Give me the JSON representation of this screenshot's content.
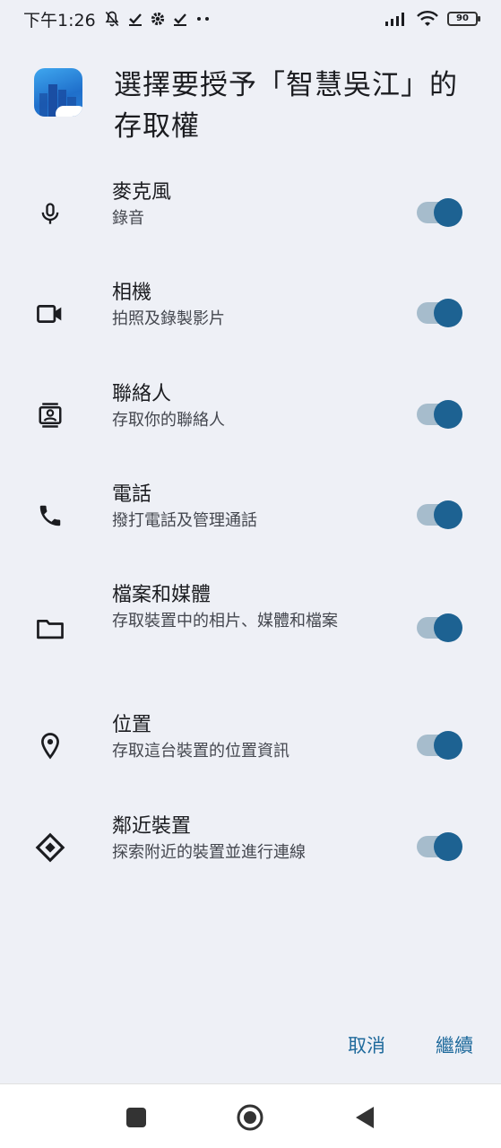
{
  "status_bar": {
    "time": "下午1:26",
    "battery": "90",
    "left_icons": [
      "mute-icon",
      "check-icon",
      "gear-icon",
      "check-icon",
      "more-dots-icon"
    ],
    "right_icons": [
      "signal-icon",
      "wifi-icon",
      "battery-icon"
    ]
  },
  "dialog": {
    "title": "選擇要授予「智慧吳江」的存取權",
    "app_icon": "smart-wujiang-app-icon"
  },
  "permissions": [
    {
      "icon": "microphone-icon",
      "title": "麥克風",
      "subtitle": "錄音",
      "enabled": true
    },
    {
      "icon": "camera-icon",
      "title": "相機",
      "subtitle": "拍照及錄製影片",
      "enabled": true
    },
    {
      "icon": "contacts-icon",
      "title": "聯絡人",
      "subtitle": "存取你的聯絡人",
      "enabled": true
    },
    {
      "icon": "phone-icon",
      "title": "電話",
      "subtitle": "撥打電話及管理通話",
      "enabled": true
    },
    {
      "icon": "folder-icon",
      "title": "檔案和媒體",
      "subtitle": "存取裝置中的相片、媒體和檔案",
      "enabled": true
    },
    {
      "icon": "location-icon",
      "title": "位置",
      "subtitle": "存取這台裝置的位置資訊",
      "enabled": true
    },
    {
      "icon": "nearby-devices-icon",
      "title": "鄰近裝置",
      "subtitle": "探索附近的裝置並進行連線",
      "enabled": true
    }
  ],
  "actions": {
    "cancel_label": "取消",
    "continue_label": "繼續"
  },
  "nav_bar": {
    "icons": [
      "recents-icon",
      "home-icon",
      "back-icon"
    ]
  },
  "colors": {
    "background": "#eef0f6",
    "accent": "#1d6292",
    "toggle_track": "#a6bccc",
    "button_text": "#1f6a9c"
  }
}
